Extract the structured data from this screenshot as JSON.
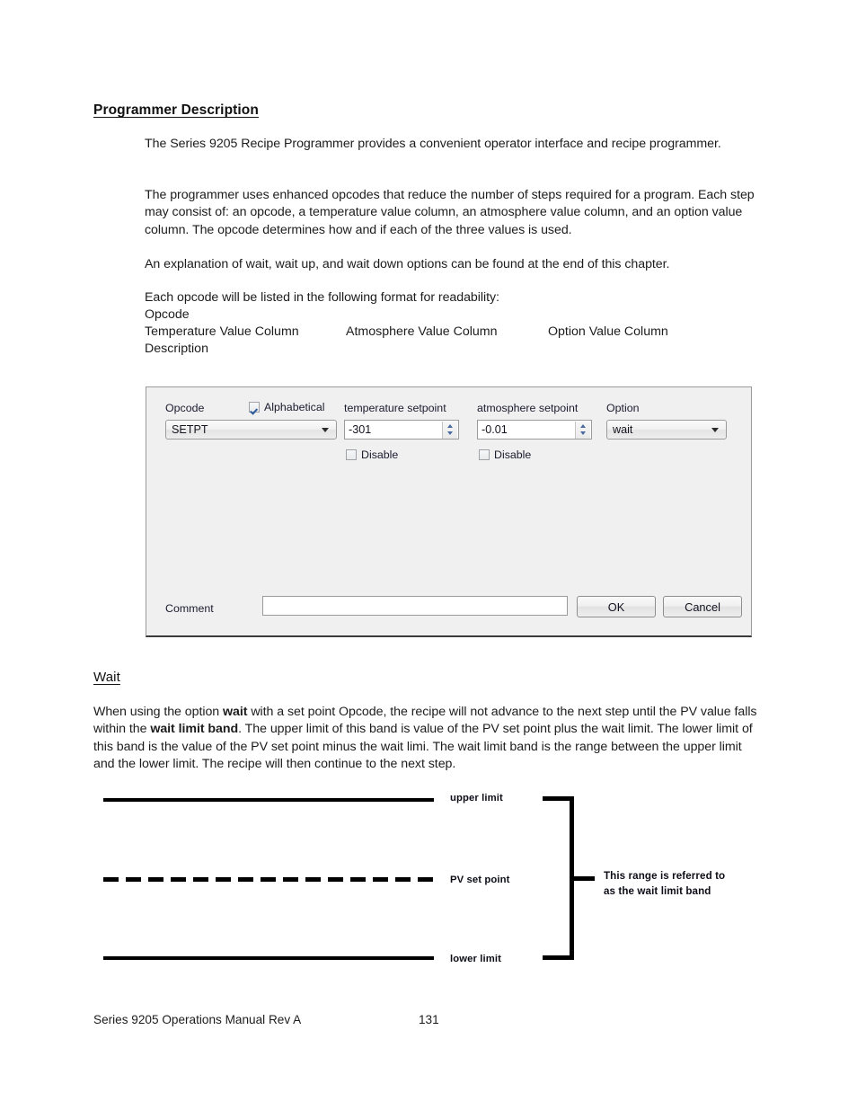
{
  "document": {
    "heading": "Programmer Description",
    "paragraphs": [
      "The Series 9205 Recipe Programmer provides a convenient operator interface and recipe programmer.",
      "The programmer uses enhanced opcodes that reduce the number of steps required for a program.  Each step may consist of: an opcode, a temperature value column, an atmosphere value column, and an option value column.  The opcode determines how and if each of the three values is used.",
      "An explanation of wait, wait up, and wait down options can be found at the end of this chapter.",
      "Each opcode will be listed in the following format for readability:"
    ],
    "format_block": {
      "opcode_line": "Opcode",
      "columns": [
        "Temperature Value Column",
        "Atmosphere Value Column",
        "Option Value Column"
      ],
      "description_line": "Description"
    }
  },
  "dialog": {
    "opcode_label": "Opcode",
    "alphabetical_label": "Alphabetical",
    "alphabetical_checked": true,
    "opcode_value": "SETPT",
    "temperature_label": "temperature setpoint",
    "temperature_value": "-301",
    "temperature_disable_label": "Disable",
    "temperature_disable_checked": false,
    "atmosphere_label": "atmosphere setpoint",
    "atmosphere_value": "-0.01",
    "atmosphere_disable_label": "Disable",
    "atmosphere_disable_checked": false,
    "option_label": "Option",
    "option_value": "wait",
    "comment_label": "Comment",
    "comment_value": "",
    "ok_label": "OK",
    "cancel_label": "Cancel"
  },
  "wait_section": {
    "heading": "Wait",
    "paragraph_parts": [
      "When using the option ",
      "wait",
      " with a set point Opcode, the recipe will not advance to the next step until the PV value falls within the ",
      "wait limit band",
      ".  The upper limit of this band is value of the PV set point plus the wait limit.  The lower limit of this band is the value of the PV set point minus the wait limi.  The wait limit band is the range between the upper limit and the lower limit.  The recipe will then continue to the next step."
    ]
  },
  "diagram": {
    "upper_limit_label": "upper limit",
    "pv_set_point_label": "PV set point",
    "lower_limit_label": "lower limit",
    "range_note": "This range is referred to\nas the wait limit band"
  },
  "footer": {
    "manual": "Series 9205 Operations Manual Rev A",
    "page_number": "131"
  }
}
